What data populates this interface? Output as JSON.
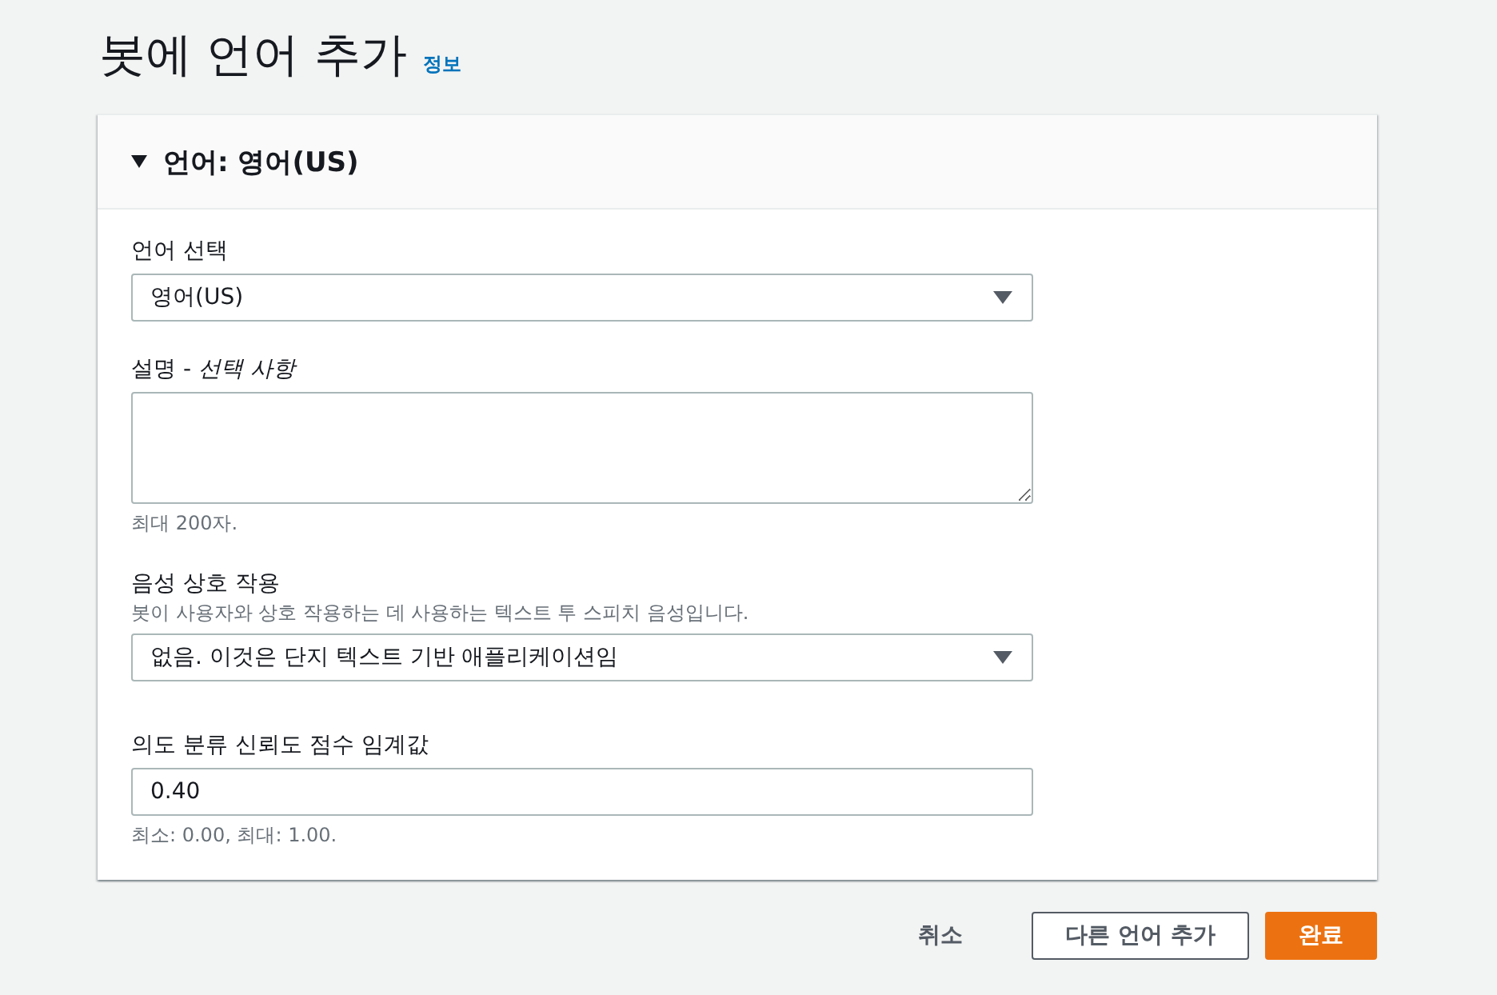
{
  "page": {
    "title": "봇에 언어 추가",
    "info_link": "정보"
  },
  "section": {
    "title": "언어: 영어(US)",
    "expanded": true,
    "fields": [
      {
        "kind": "select",
        "label": "언어 선택",
        "value": "영어(US)"
      },
      {
        "kind": "textarea",
        "label": "설명 - *선택 사항*",
        "hint": "최대 200자."
      },
      {
        "kind": "select",
        "label": "음성 상호 작용",
        "description": "봇이 사용자와 상호 작용하는 데 사용하는 텍스트 투 스피치 음성입니다.",
        "value": "없음. 이것은 단지 텍스트 기반 애플리케이션임"
      },
      {
        "kind": "input",
        "label": "의도 분류 신뢰도 점수 임계값",
        "value": "0.40",
        "hint": "최소: 0.00, 최대: 1.00."
      }
    ]
  },
  "actions": [
    {
      "kind": "link",
      "label": "취소"
    },
    {
      "kind": "secondary",
      "label": "다른 언어 추가"
    },
    {
      "kind": "primary",
      "label": "완료"
    }
  ]
}
